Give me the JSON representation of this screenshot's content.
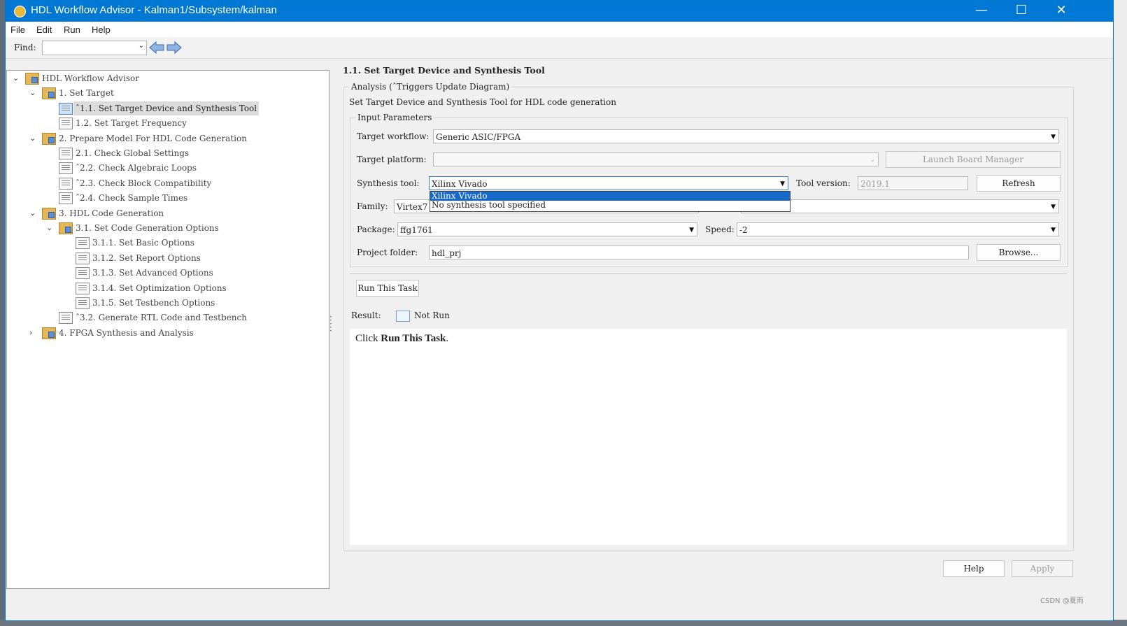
{
  "window": {
    "title": "HDL Workflow Advisor - Kalman1/Subsystem/kalman",
    "controls": {
      "minimize": "—",
      "maximize": "☐",
      "close": "✕"
    }
  },
  "menu": [
    "File",
    "Edit",
    "Run",
    "Help"
  ],
  "toolbar": {
    "find_label": "Find:",
    "find_value": "",
    "back_icon": "left-arrow-icon",
    "forward_icon": "right-arrow-icon"
  },
  "tree": [
    {
      "label": "HDL Workflow Advisor",
      "twisty": "⌄",
      "icon": "folder",
      "level": 0
    },
    {
      "label": "1. Set Target",
      "twisty": "⌄",
      "icon": "folder",
      "level": 1
    },
    {
      "label": "ˆ1.1. Set Target Device and Synthesis Tool",
      "twisty": "",
      "icon": "task",
      "level": 2,
      "selected": true
    },
    {
      "label": "1.2. Set Target Frequency",
      "twisty": "",
      "icon": "task",
      "level": 2
    },
    {
      "label": "2. Prepare Model For HDL Code Generation",
      "twisty": "⌄",
      "icon": "folder",
      "level": 1
    },
    {
      "label": "2.1. Check Global Settings",
      "twisty": "",
      "icon": "task",
      "level": 2
    },
    {
      "label": "ˆ2.2. Check Algebraic Loops",
      "twisty": "",
      "icon": "task",
      "level": 2
    },
    {
      "label": "ˆ2.3. Check Block Compatibility",
      "twisty": "",
      "icon": "task",
      "level": 2
    },
    {
      "label": "ˆ2.4. Check Sample Times",
      "twisty": "",
      "icon": "task",
      "level": 2
    },
    {
      "label": "3. HDL Code Generation",
      "twisty": "⌄",
      "icon": "folder",
      "level": 1
    },
    {
      "label": "3.1. Set Code Generation Options",
      "twisty": "⌄",
      "icon": "folder",
      "level": 2
    },
    {
      "label": "3.1.1. Set Basic Options",
      "twisty": "",
      "icon": "task",
      "level": 3
    },
    {
      "label": "3.1.2. Set Report Options",
      "twisty": "",
      "icon": "task",
      "level": 3
    },
    {
      "label": "3.1.3. Set Advanced Options",
      "twisty": "",
      "icon": "task",
      "level": 3
    },
    {
      "label": "3.1.4. Set Optimization Options",
      "twisty": "",
      "icon": "task",
      "level": 3
    },
    {
      "label": "3.1.5. Set Testbench Options",
      "twisty": "",
      "icon": "task",
      "level": 3
    },
    {
      "label": "ˆ3.2. Generate RTL Code and Testbench",
      "twisty": "",
      "icon": "task",
      "level": 2
    },
    {
      "label": "4. FPGA Synthesis and Analysis",
      "twisty": "›",
      "icon": "folder",
      "level": 1
    }
  ],
  "right": {
    "title": "1.1. Set Target Device and Synthesis Tool",
    "analysis_legend": "Analysis (ˆTriggers Update Diagram)",
    "description": "Set Target Device and Synthesis Tool for HDL code generation",
    "input_legend": "Input Parameters",
    "target_workflow_label": "Target workflow:",
    "target_workflow_value": "Generic ASIC/FPGA",
    "target_platform_label": "Target platform:",
    "target_platform_value": "",
    "launch_board_manager": "Launch Board Manager",
    "synthesis_tool_label": "Synthesis tool:",
    "synthesis_tool_value": "Xilinx Vivado",
    "synthesis_tool_options": [
      "Xilinx Vivado",
      "No synthesis tool specified"
    ],
    "tool_version_label": "Tool version:",
    "tool_version_value": "2019.1",
    "refresh": "Refresh",
    "family_label": "Family:",
    "family_value": "Virtex7",
    "package_label": "Package:",
    "package_value": "ffg1761",
    "speed_label": "Speed:",
    "speed_value": "-2",
    "project_folder_label": "Project folder:",
    "project_folder_value": "hdl_prj",
    "browse": "Browse...",
    "run_task": "Run This Task",
    "result_label": "Result:",
    "result_value": "Not Run",
    "html_prefix": "Click ",
    "html_bold": "Run This Task",
    "html_suffix": ".",
    "help": "Help",
    "apply": "Apply"
  },
  "watermark": "CSDN @夏雨"
}
